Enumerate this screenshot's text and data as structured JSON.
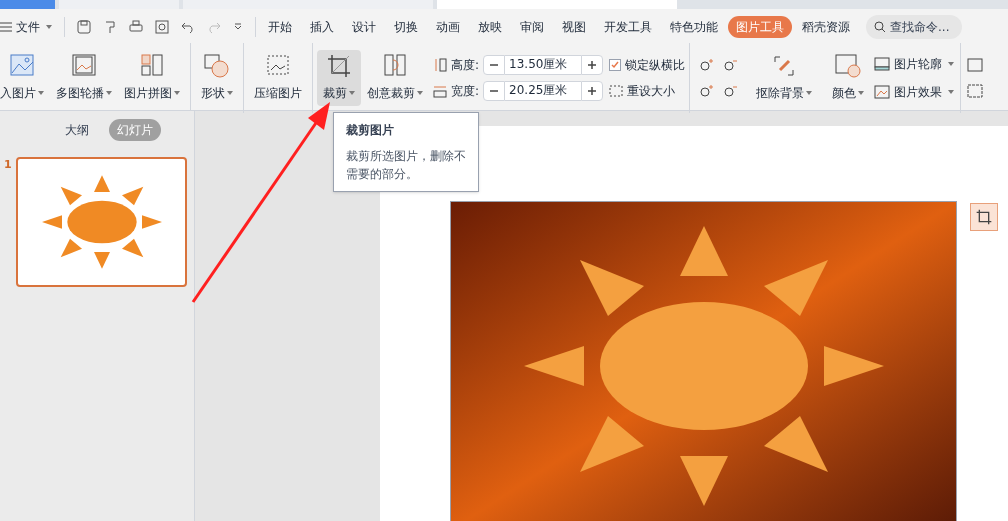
{
  "menu": {
    "file": "文件",
    "tabs": [
      {
        "label": "开始",
        "selected": false
      },
      {
        "label": "插入",
        "selected": false
      },
      {
        "label": "设计",
        "selected": false
      },
      {
        "label": "切换",
        "selected": false
      },
      {
        "label": "动画",
        "selected": false
      },
      {
        "label": "放映",
        "selected": false
      },
      {
        "label": "审阅",
        "selected": false
      },
      {
        "label": "视图",
        "selected": false
      },
      {
        "label": "开发工具",
        "selected": false
      },
      {
        "label": "特色功能",
        "selected": false
      },
      {
        "label": "图片工具",
        "selected": true
      },
      {
        "label": "稻壳资源",
        "selected": false
      }
    ],
    "search": {
      "placeholder": "查找命令..."
    }
  },
  "ribbon": {
    "buttons": [
      {
        "kind": "insert",
        "label": "入图片",
        "dropdown": true,
        "selected": false
      },
      {
        "kind": "carousel",
        "label": "多图轮播",
        "dropdown": true,
        "selected": false
      },
      {
        "kind": "collage",
        "label": "图片拼图",
        "dropdown": true,
        "selected": false
      },
      {
        "kind": "shape",
        "label": "形状",
        "dropdown": true,
        "selected": false
      },
      {
        "kind": "compress",
        "label": "压缩图片",
        "dropdown": false,
        "selected": false
      },
      {
        "kind": "crop",
        "label": "裁剪",
        "dropdown": true,
        "selected": true
      },
      {
        "kind": "creative",
        "label": "创意裁剪",
        "dropdown": true,
        "selected": false
      }
    ],
    "size": [
      {
        "kind": "height",
        "label": "高度:",
        "value": "13.50厘米"
      },
      {
        "kind": "width",
        "label": "宽度:",
        "value": "20.25厘米"
      }
    ],
    "lock_ratio": {
      "label": "锁定纵横比",
      "checked": true
    },
    "reset": "重设大小",
    "tools": [
      {
        "kind": "remove-bg",
        "label": "抠除背景"
      },
      {
        "kind": "color",
        "label": "颜色"
      }
    ],
    "styles": [
      {
        "kind": "outline",
        "label": "图片轮廓"
      },
      {
        "kind": "effect",
        "label": "图片效果"
      }
    ]
  },
  "sidebar": {
    "tabs": [
      {
        "label": "大纲",
        "selected": false
      },
      {
        "label": "幻灯片",
        "selected": true
      }
    ],
    "slides": [
      {
        "number": "1",
        "selected": true
      }
    ]
  },
  "tooltip": {
    "title": "裁剪图片",
    "text": "裁剪所选图片，删除不需要的部分。"
  }
}
